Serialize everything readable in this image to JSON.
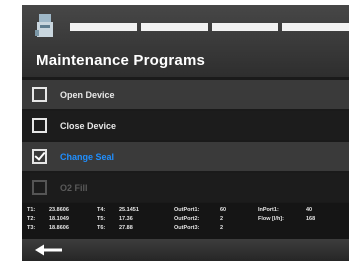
{
  "header": {
    "icon": "device-icon",
    "progress_segments": 4,
    "title": "Maintenance Programs"
  },
  "menu": [
    {
      "label": "Open Device",
      "checked": false,
      "state": "normal"
    },
    {
      "label": "Close Device",
      "checked": false,
      "state": "normal"
    },
    {
      "label": "Change Seal",
      "checked": true,
      "state": "active"
    },
    {
      "label": "O2 Fill",
      "checked": false,
      "state": "disabled"
    }
  ],
  "readouts": {
    "col1": [
      {
        "key": "T1:",
        "value": "23.8606"
      },
      {
        "key": "T2:",
        "value": "18.1049"
      },
      {
        "key": "T3:",
        "value": "18.8606"
      }
    ],
    "col2": [
      {
        "key": "T4:",
        "value": "25.1451"
      },
      {
        "key": "T5:",
        "value": "17.36"
      },
      {
        "key": "T6:",
        "value": "27.88"
      }
    ],
    "col3": [
      {
        "key": "OutPort1:",
        "value": "60"
      },
      {
        "key": "OutPort2:",
        "value": "2"
      },
      {
        "key": "OutPort3:",
        "value": "2"
      }
    ],
    "col4": [
      {
        "key": "InPort1:",
        "value": "40"
      },
      {
        "key": "Flow [l/h]:",
        "value": "168"
      }
    ]
  },
  "footer": {
    "back_icon": "back-arrow-icon"
  },
  "colors": {
    "active": "#1f8fff",
    "background": "#1a1a1a",
    "text": "#e8e8e8"
  }
}
